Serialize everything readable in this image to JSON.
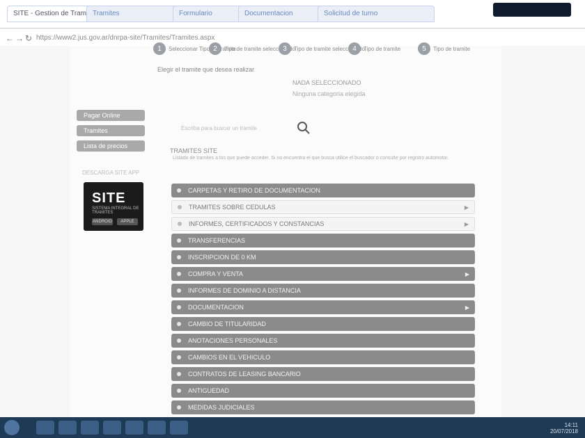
{
  "browser": {
    "tabs": [
      "SITE - Gestion de Tramites",
      "Tramites",
      "Formulario",
      "Documentacion",
      "Solicitud de turno"
    ],
    "url": "https://www2.jus.gov.ar/dnrpa-site/Tramites/Tramites.aspx"
  },
  "page": {
    "steps": [
      {
        "num": "1",
        "label": "Seleccionar Tipo de tramite"
      },
      {
        "num": "2",
        "label": "Tipo de tramite seleccionado"
      },
      {
        "num": "3",
        "label": "Tipo de tramite seleccionado"
      },
      {
        "num": "4",
        "label": "Tipo de tramite"
      },
      {
        "num": "5",
        "label": "Tipo de tramite"
      }
    ],
    "info_text": "Elegir el tramite que desea realizar",
    "center_title": "NADA SELECCIONADO",
    "center_sub": "Ninguna categoria elegida",
    "sidebar": {
      "buttons": [
        "Pagar Online",
        "Tramites",
        "Lista de precios"
      ],
      "caption": "DESCARGA SITE APP"
    },
    "logo": {
      "text": "SITE",
      "sub": "SISTEMA INTEGRAL DE TRAMITES",
      "btn1": "ANDROID",
      "btn2": "APPLE"
    },
    "search": {
      "hint": "Escriba para buscar un tramite"
    },
    "section": {
      "title": "TRAMITES SITE",
      "desc": "Listado de tramites a los que puede acceder. Si no encuentra el que busca utilice el buscador o consulte por registro automotor."
    },
    "accordion": [
      {
        "label": "CARPETAS Y RETIRO DE DOCUMENTACION",
        "style": "gray",
        "arrow": false
      },
      {
        "label": "TRAMITES SOBRE CEDULAS",
        "style": "white",
        "arrow": true
      },
      {
        "label": "INFORMES, CERTIFICADOS Y CONSTANCIAS",
        "style": "white",
        "arrow": true
      },
      {
        "label": "TRANSFERENCIAS",
        "style": "gray",
        "arrow": false
      },
      {
        "label": "INSCRIPCION DE 0 KM",
        "style": "gray",
        "arrow": false
      },
      {
        "label": "COMPRA Y VENTA",
        "style": "gray",
        "arrow": true
      },
      {
        "label": "INFORMES DE DOMINIO A DISTANCIA",
        "style": "gray",
        "arrow": false
      },
      {
        "label": "DOCUMENTACION",
        "style": "gray",
        "arrow": true
      },
      {
        "label": "CAMBIO DE TITULARIDAD",
        "style": "gray",
        "arrow": false
      },
      {
        "label": "ANOTACIONES PERSONALES",
        "style": "gray",
        "arrow": false
      },
      {
        "label": "CAMBIOS EN EL VEHICULO",
        "style": "gray",
        "arrow": false
      },
      {
        "label": "CONTRATOS DE LEASING BANCARIO",
        "style": "gray",
        "arrow": false
      },
      {
        "label": "ANTIGUEDAD",
        "style": "gray",
        "arrow": false
      },
      {
        "label": "MEDIDAS JUDICIALES",
        "style": "gray",
        "arrow": false
      }
    ]
  },
  "taskbar": {
    "time": "14:11",
    "date": "20/07/2018"
  }
}
